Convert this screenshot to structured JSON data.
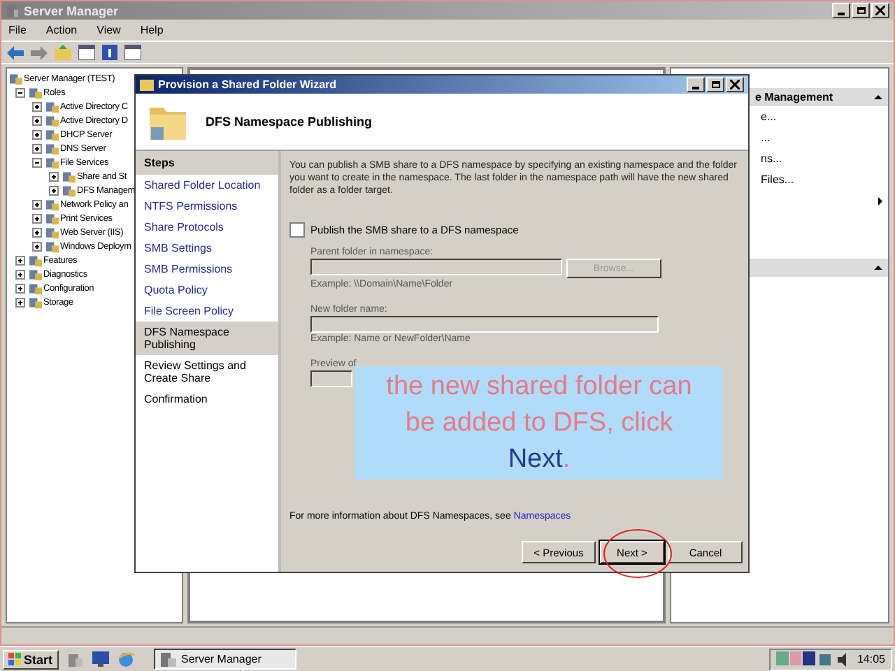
{
  "window": {
    "title": "Server Manager",
    "menu": [
      "File",
      "Action",
      "View",
      "Help"
    ]
  },
  "tree": [
    {
      "label": "Server Manager (TEST)",
      "children": [
        {
          "label": "Roles",
          "expanded": true,
          "children": [
            {
              "label": "Active Directory C",
              "expanded": false
            },
            {
              "label": "Active Directory D",
              "expanded": false
            },
            {
              "label": "DHCP Server",
              "expanded": false
            },
            {
              "label": "DNS Server",
              "expanded": false
            },
            {
              "label": "File Services",
              "expanded": true,
              "children": [
                {
                  "label": "Share and St",
                  "expanded": false
                },
                {
                  "label": "DFS Managem",
                  "expanded": false
                }
              ]
            },
            {
              "label": "Network Policy an",
              "expanded": false
            },
            {
              "label": "Print Services",
              "expanded": false
            },
            {
              "label": "Web Server (IIS)",
              "expanded": false
            },
            {
              "label": "Windows Deploym",
              "expanded": false
            }
          ]
        },
        {
          "label": "Features",
          "expanded": false
        },
        {
          "label": "Diagnostics",
          "expanded": false
        },
        {
          "label": "Configuration",
          "expanded": false
        },
        {
          "label": "Storage",
          "expanded": false
        }
      ]
    }
  ],
  "actions": {
    "title": "e Management",
    "items": [
      "e...",
      "...",
      "ns...",
      "Files..."
    ]
  },
  "wizard": {
    "title": "Provision a Shared Folder Wizard",
    "heading": "DFS Namespace Publishing",
    "steps_title": "Steps",
    "steps": [
      {
        "label": "Shared Folder Location",
        "completed": true,
        "selected": false
      },
      {
        "label": "NTFS Permissions",
        "completed": true,
        "selected": false
      },
      {
        "label": "Share Protocols",
        "completed": true,
        "selected": false
      },
      {
        "label": "SMB Settings",
        "completed": true,
        "selected": false
      },
      {
        "label": "SMB Permissions",
        "completed": true,
        "selected": false
      },
      {
        "label": "Quota Policy",
        "completed": true,
        "selected": false
      },
      {
        "label": "File Screen Policy",
        "completed": true,
        "selected": false
      },
      {
        "label": "DFS Namespace Publishing",
        "completed": false,
        "selected": true
      },
      {
        "label": "Review Settings and Create Share",
        "completed": false,
        "selected": false
      },
      {
        "label": "Confirmation",
        "completed": false,
        "selected": false
      }
    ],
    "description": "You can publish a SMB share to a DFS namespace by specifying an existing namespace and the folder you want to create in the namespace. The last folder in the namespace path will have the new shared folder as a folder target.",
    "publish": {
      "label": "Publish the SMB share to a DFS namespace",
      "checked": false
    },
    "options_disabled": true,
    "parent": {
      "label": "Parent folder in namespace:",
      "browse": "Browse...",
      "example": "Example: \\\\Domain\\Name\\Folder"
    },
    "newfolder": {
      "label": "New folder name:",
      "example": "Example: Name or NewFolder\\Name"
    },
    "preview": {
      "label": "Preview of"
    },
    "footer": {
      "text": "For more information about DFS Namespaces, see",
      "link": "Namespaces"
    },
    "buttons": [
      {
        "label": "< Previous",
        "kind": "normal"
      },
      {
        "label": "Next >",
        "kind": "default"
      },
      {
        "label": "Cancel",
        "kind": "normal"
      }
    ]
  },
  "callout": {
    "text": "the new shared folder can be added to DFS, click",
    "highlight": "Next",
    "end": "."
  },
  "taskbar": {
    "start": "Start",
    "tasks": [
      {
        "label": "Server Manager",
        "selected": true
      }
    ],
    "clock": "14:05"
  }
}
